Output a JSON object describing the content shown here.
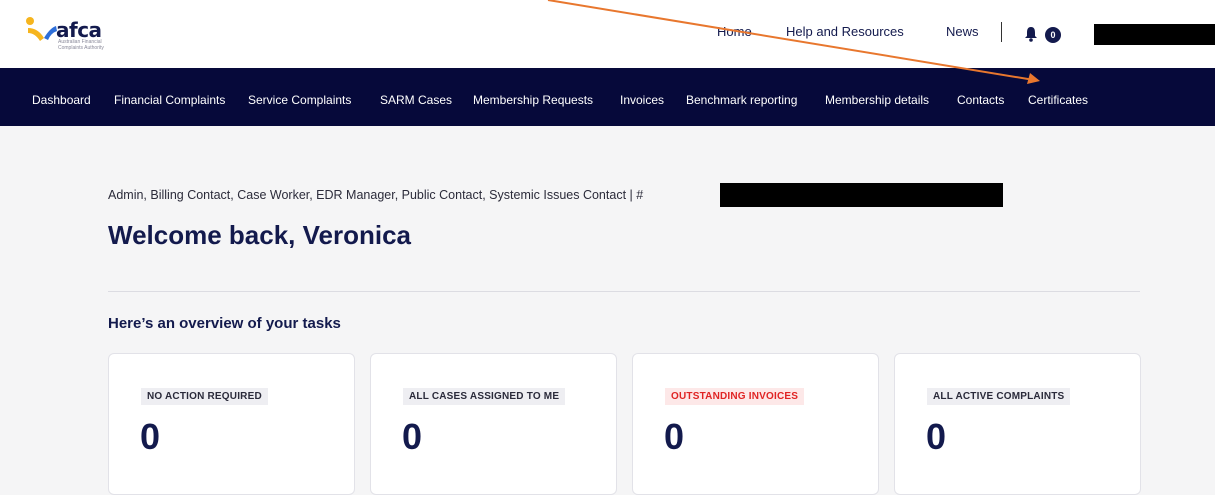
{
  "header": {
    "logo_text": "afca",
    "logo_subtitle": "Australian Financial Complaints Authority",
    "nav": [
      "Home",
      "Help and Resources",
      "News"
    ],
    "notification_count": "0"
  },
  "main_nav": {
    "items": [
      "Dashboard",
      "Financial Complaints",
      "Service Complaints",
      "SARM Cases",
      "Membership Requests",
      "Invoices",
      "Benchmark reporting",
      "Membership details",
      "Contacts",
      "Certificates"
    ]
  },
  "page": {
    "roles": "Admin, Billing Contact, Case Worker, EDR Manager, Public Contact, Systemic Issues Contact | #",
    "welcome": "Welcome back, Veronica",
    "overview_heading": "Here’s an overview of your tasks"
  },
  "cards": [
    {
      "label": "NO ACTION REQUIRED",
      "value": "0"
    },
    {
      "label": "ALL CASES ASSIGNED TO ME",
      "value": "0"
    },
    {
      "label": "OUTSTANDING INVOICES",
      "value": "0"
    },
    {
      "label": "ALL ACTIVE COMPLAINTS",
      "value": "0"
    }
  ],
  "colors": {
    "nav_bg": "#06093a",
    "brand_navy": "#131a4d",
    "logo_yellow": "#f6b51e",
    "logo_blue": "#2e6fd9",
    "annotation_arrow": "#e8772e",
    "alert_red": "#e02424"
  },
  "icons": {
    "bell": "bell-icon"
  }
}
